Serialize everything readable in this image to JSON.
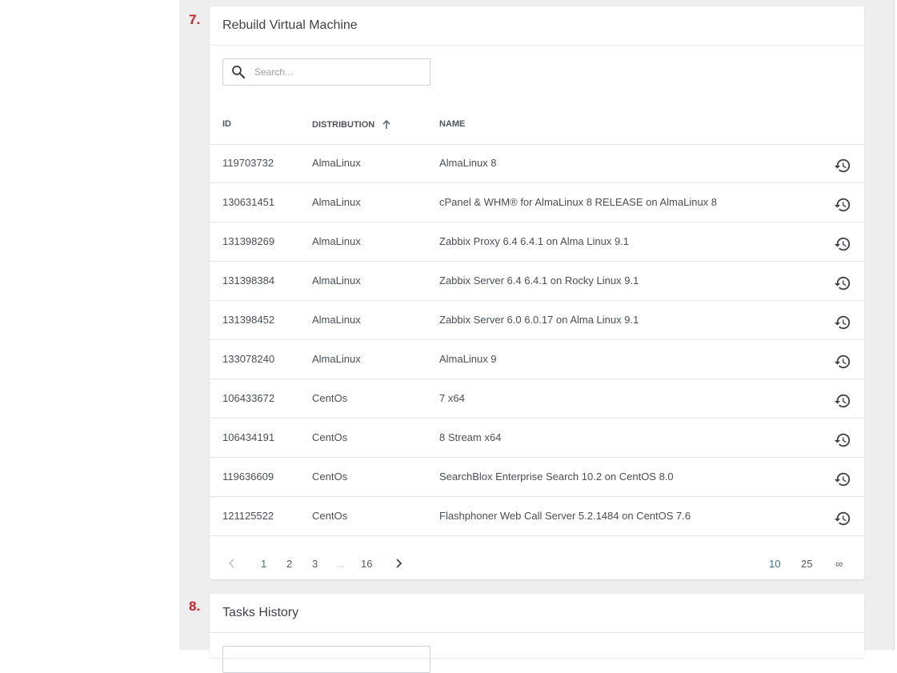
{
  "steps": {
    "rebuild_num": "7.",
    "tasks_num": "8."
  },
  "rebuild": {
    "title": "Rebuild Virtual Machine",
    "search_placeholder": "Search...",
    "columns": {
      "id": "ID",
      "distribution": "DISTRIBUTION",
      "name": "NAME"
    },
    "sort": {
      "column": "distribution",
      "direction": "ascending",
      "icon": "arrow-up-icon"
    },
    "action_icon": "restore-icon",
    "rows": [
      {
        "id": "119703732",
        "distribution": "AlmaLinux",
        "name": "AlmaLinux 8"
      },
      {
        "id": "130631451",
        "distribution": "AlmaLinux",
        "name": "cPanel & WHM® for AlmaLinux 8 RELEASE on AlmaLinux 8"
      },
      {
        "id": "131398269",
        "distribution": "AlmaLinux",
        "name": "Zabbix Proxy 6.4 6.4.1 on Alma Linux 9.1"
      },
      {
        "id": "131398384",
        "distribution": "AlmaLinux",
        "name": "Zabbix Server 6.4 6.4.1 on Rocky Linux 9.1"
      },
      {
        "id": "131398452",
        "distribution": "AlmaLinux",
        "name": "Zabbix Server 6.0 6.0.17 on Alma Linux 9.1"
      },
      {
        "id": "133078240",
        "distribution": "AlmaLinux",
        "name": "AlmaLinux 9"
      },
      {
        "id": "106433672",
        "distribution": "CentOs",
        "name": "7 x64"
      },
      {
        "id": "106434191",
        "distribution": "CentOs",
        "name": "8 Stream x64"
      },
      {
        "id": "119636609",
        "distribution": "CentOs",
        "name": "SearchBlox Enterprise Search 10.2 on CentOS 8.0"
      },
      {
        "id": "121125522",
        "distribution": "CentOs",
        "name": "Flashphoner Web Call Server 5.2.1484 on CentOS 7.6"
      }
    ],
    "pagination": {
      "pages": [
        "1",
        "2",
        "3",
        "...",
        "16"
      ],
      "current_page": "1",
      "page_sizes": [
        "10",
        "25",
        "∞"
      ],
      "current_size": "10"
    }
  },
  "tasks": {
    "title": "Tasks History"
  },
  "colors": {
    "accent": "#3d6fa8",
    "step_number": "#d0202a",
    "background": "#eeeeee"
  }
}
